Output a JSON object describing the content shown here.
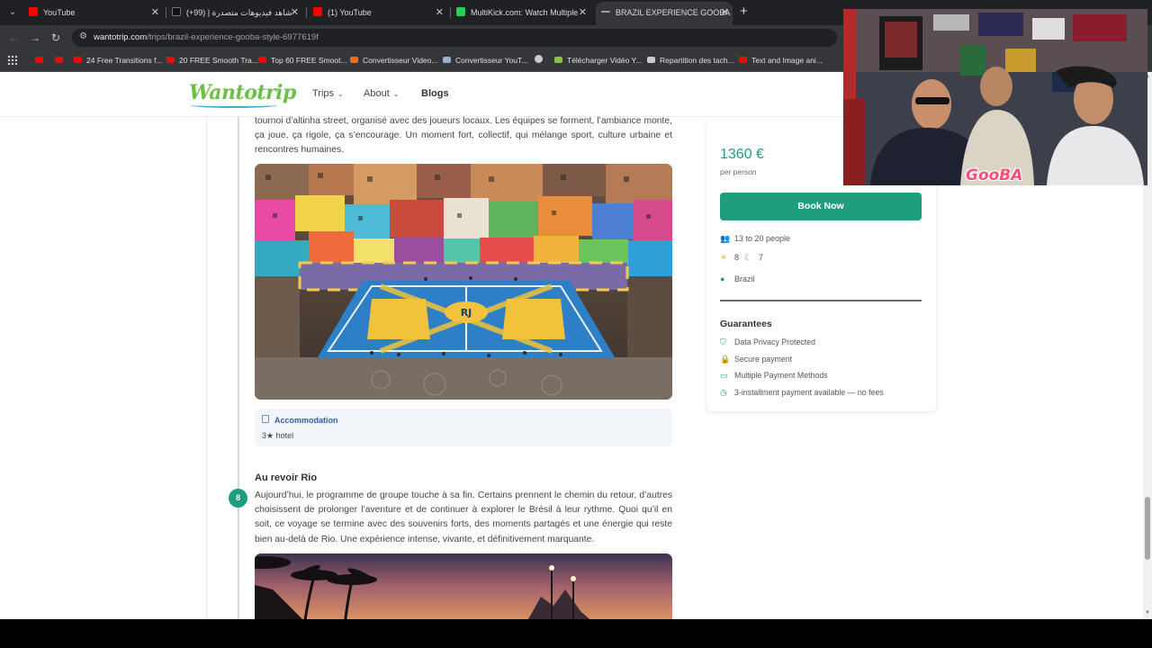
{
  "browser": {
    "tabs": [
      {
        "title": "YouTube",
        "favicon_color": "#ff0000",
        "closeable": true
      },
      {
        "title": "شاهد فيديوهات متصدرة | (99+)",
        "favicon_color": "#111111",
        "closeable": true
      },
      {
        "title": "(1) YouTube",
        "favicon_color": "#ff0000",
        "closeable": true
      },
      {
        "title": "MultiKick.com: Watch Multiple",
        "favicon_color": "#28d05a",
        "closeable": true
      },
      {
        "title": "BRAZIL EXPERIENCE GOOBA ST",
        "favicon_color": "#9aa0a6",
        "closeable": true,
        "active": true
      }
    ],
    "url_host": "wantotrip.com",
    "url_path": "/trips/brazil-experience-gooba-style-6977619f",
    "bookmarks": [
      {
        "label": "",
        "icon_color": "#ff0000"
      },
      {
        "label": "",
        "icon_color": "#ff0000"
      },
      {
        "label": "24 Free Transitions f...",
        "icon_color": "#ff0000"
      },
      {
        "label": "20 FREE Smooth Tra...",
        "icon_color": "#ff0000"
      },
      {
        "label": "Top 60 FREE Smoot...",
        "icon_color": "#ff0000"
      },
      {
        "label": "Convertisseur Video...",
        "icon_color": "#f26a1b"
      },
      {
        "label": "Convertisseur YouT...",
        "icon_color": "#9ab0c8"
      },
      {
        "label": "",
        "icon_color": "#cccccc"
      },
      {
        "label": "Télécharger Vidéo Y...",
        "icon_color": "#8bc34a"
      },
      {
        "label": "Repartition des tach...",
        "icon_color": "#cccccc"
      },
      {
        "label": "Text and Image ani...",
        "icon_color": "#ff0000"
      }
    ]
  },
  "site": {
    "logo": "Wantotrip",
    "nav": [
      {
        "label": "Trips",
        "has_dropdown": true
      },
      {
        "label": "About",
        "has_dropdown": true
      },
      {
        "label": "Blogs",
        "has_dropdown": false
      }
    ]
  },
  "itinerary": {
    "intro_text": "tournoi d’altinha street, organisé avec des joueurs locaux. Les équipes se forment, l’ambiance monte, ça joue, ça rigole, ça s’encourage. Un moment fort, collectif, qui mélange sport, culture urbaine et rencontres humaines.",
    "accommodation_title": "Accommodation",
    "accommodation_value": "3★ hotel",
    "day_number": "8",
    "day_title": "Au revoir Rio",
    "day_text": "Aujourd’hui, le programme de groupe touche à sa fin. Certains prennent le chemin du retour, d’autres choisissent de prolonger l’aventure et de continuer à explorer le Brésil à leur rythme. Quoi qu’il en soit, ce voyage se termine avec des souvenirs forts, des moments partagés et une énergie qui reste bien au-delà de Rio. Une expérience intense, vivante, et définitivement marquante.",
    "photo1_court_label": "RJ"
  },
  "booking": {
    "price": "1360 €",
    "per_person": "per person",
    "book_button": "Book Now",
    "group_size": "13 to 20 people",
    "days": "8",
    "nights": "7",
    "location": "Brazil",
    "guarantees_title": "Guarantees",
    "guarantees": [
      {
        "label": "Data Privacy Protected",
        "icon": "shield-check-icon"
      },
      {
        "label": "Secure payment",
        "icon": "lock-icon"
      },
      {
        "label": "Multiple Payment Methods",
        "icon": "credit-card-icon"
      },
      {
        "label": "3-installment payment available — no fees",
        "icon": "clock-icon"
      }
    ],
    "accent_color": "#1f9e7e"
  },
  "overlay": {
    "webcam_tag": "GooBA"
  }
}
